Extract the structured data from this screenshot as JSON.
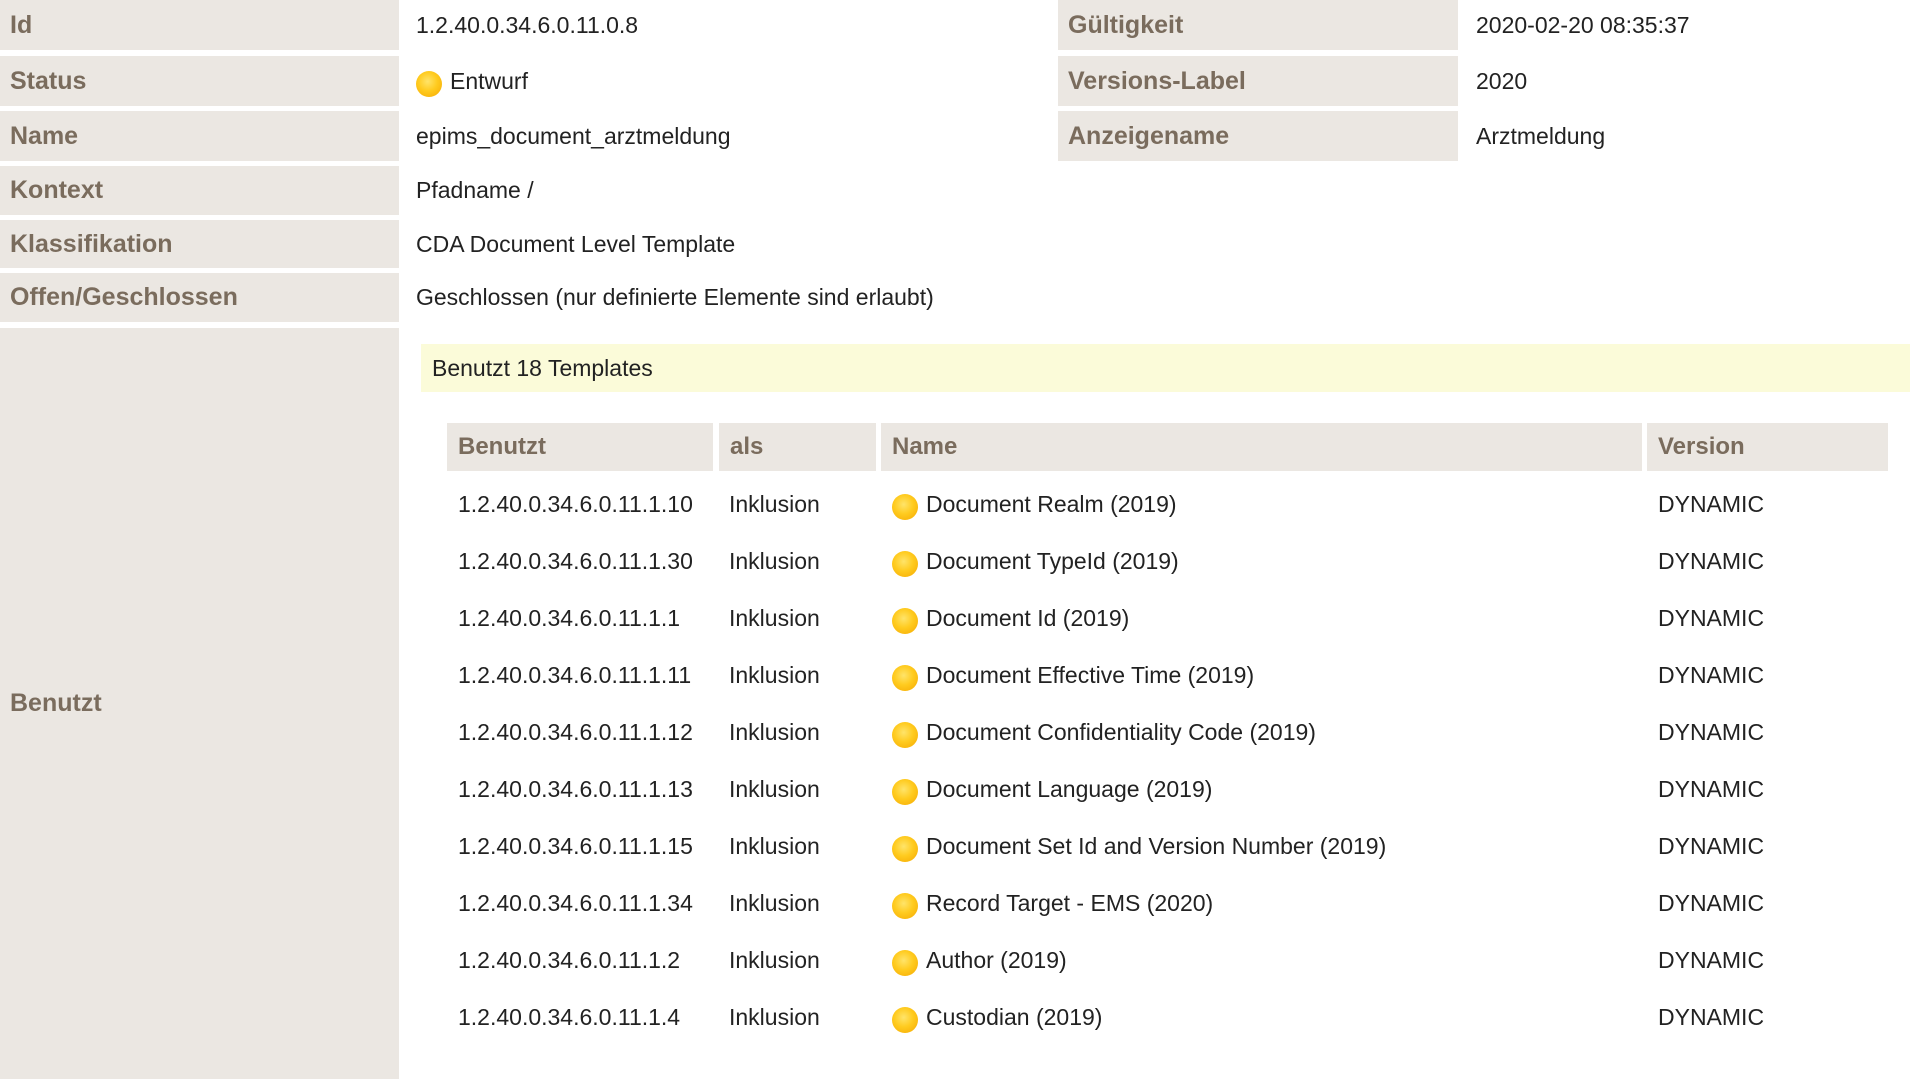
{
  "details": {
    "id": {
      "label": "Id",
      "value": "1.2.40.0.34.6.0.11.0.8"
    },
    "validity": {
      "label": "Gültigkeit",
      "value": "2020-02-20 08:35:37"
    },
    "status": {
      "label": "Status",
      "value": "Entwurf",
      "icon": "status-draft-icon",
      "color": "#ffc21a"
    },
    "version_label": {
      "label": "Versions-Label",
      "value": "2020"
    },
    "name": {
      "label": "Name",
      "value": "epims_document_arztmeldung"
    },
    "display_name": {
      "label": "Anzeigename",
      "value": "Arztmeldung"
    },
    "context": {
      "label": "Kontext",
      "value": "Pfadname /"
    },
    "classification": {
      "label": "Klassifikation",
      "value": "CDA Document Level Template"
    },
    "open_closed": {
      "label": "Offen/Geschlossen",
      "value": "Geschlossen (nur definierte Elemente sind erlaubt)"
    },
    "uses": {
      "label": "Benutzt"
    }
  },
  "uses_section": {
    "banner": "Benutzt 18 Templates",
    "columns": {
      "used": "Benutzt",
      "as": "als",
      "name": "Name",
      "version": "Version"
    },
    "rows": [
      {
        "id": "1.2.40.0.34.6.0.11.1.10",
        "as": "Inklusion",
        "name": "Document Realm (2019)",
        "version": "DYNAMIC"
      },
      {
        "id": "1.2.40.0.34.6.0.11.1.30",
        "as": "Inklusion",
        "name": "Document TypeId (2019)",
        "version": "DYNAMIC"
      },
      {
        "id": "1.2.40.0.34.6.0.11.1.1",
        "as": "Inklusion",
        "name": "Document Id (2019)",
        "version": "DYNAMIC"
      },
      {
        "id": "1.2.40.0.34.6.0.11.1.11",
        "as": "Inklusion",
        "name": "Document Effective Time (2019)",
        "version": "DYNAMIC"
      },
      {
        "id": "1.2.40.0.34.6.0.11.1.12",
        "as": "Inklusion",
        "name": "Document Confidentiality Code (2019)",
        "version": "DYNAMIC"
      },
      {
        "id": "1.2.40.0.34.6.0.11.1.13",
        "as": "Inklusion",
        "name": "Document Language (2019)",
        "version": "DYNAMIC"
      },
      {
        "id": "1.2.40.0.34.6.0.11.1.15",
        "as": "Inklusion",
        "name": "Document Set Id and Version Number (2019)",
        "version": "DYNAMIC"
      },
      {
        "id": "1.2.40.0.34.6.0.11.1.34",
        "as": "Inklusion",
        "name": "Record Target - EMS (2020)",
        "version": "DYNAMIC"
      },
      {
        "id": "1.2.40.0.34.6.0.11.1.2",
        "as": "Inklusion",
        "name": "Author (2019)",
        "version": "DYNAMIC"
      },
      {
        "id": "1.2.40.0.34.6.0.11.1.4",
        "as": "Inklusion",
        "name": "Custodian (2019)",
        "version": "DYNAMIC"
      }
    ]
  },
  "colors": {
    "label_background": "#ebe7e2",
    "label_text": "#7a6c5d",
    "banner_background": "#fbfbd9",
    "status_draft": "#ffc21a"
  }
}
